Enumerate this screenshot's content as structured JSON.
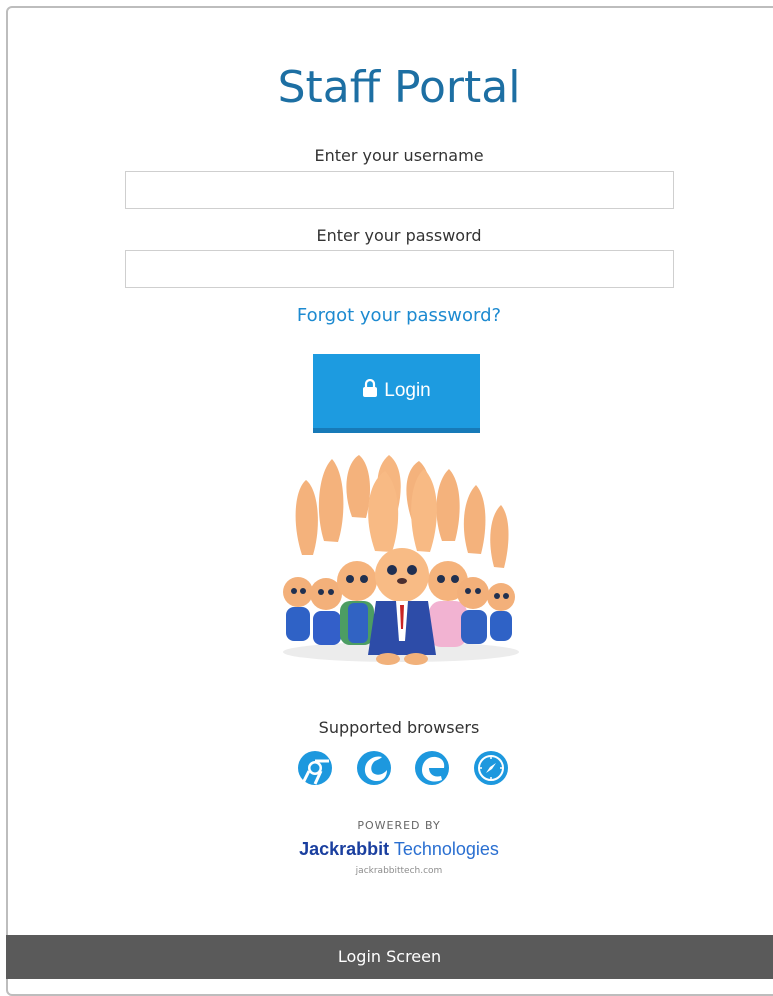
{
  "page": {
    "title": "Staff Portal",
    "footer_label": "Login Screen"
  },
  "form": {
    "username_label": "Enter your username",
    "username_value": "",
    "password_label": "Enter your password",
    "password_value": "",
    "forgot_link": "Forgot your password?",
    "login_button_label": "Login",
    "login_icon": "lock-icon"
  },
  "browsers": {
    "label": "Supported browsers",
    "icons": [
      "chrome-icon",
      "firefox-icon",
      "edge-icon",
      "safari-icon"
    ]
  },
  "branding": {
    "powered_by": "POWERED BY",
    "company_bold": "Jackrabbit",
    "company_rest": " Technologies",
    "website": "jackrabbittech.com"
  },
  "colors": {
    "title": "#1d6fa3",
    "link": "#1d8ad0",
    "button": "#1d9be0",
    "footer": "#5a5a5a"
  }
}
